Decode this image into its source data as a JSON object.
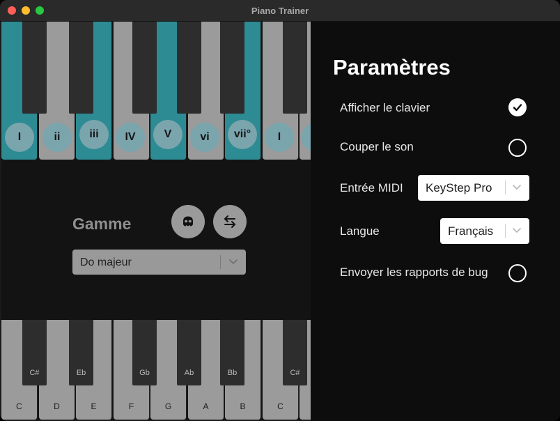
{
  "window": {
    "title": "Piano Trainer"
  },
  "top_keyboard": {
    "degrees": [
      "I",
      "ii",
      "iii",
      "IV",
      "V",
      "vi",
      "vii°",
      "I",
      ""
    ],
    "highlighted_keys": [
      "C",
      "E",
      "G",
      "B"
    ],
    "highlight_color": "#2d8b93"
  },
  "scale_panel": {
    "label": "Gamme",
    "mask_button_icon": "mask-icon",
    "swap_button_icon": "swap-arrows-icon",
    "scale_select": {
      "value": "Do majeur"
    }
  },
  "bottom_keyboard": {
    "white_keys": [
      "C",
      "D",
      "E",
      "F",
      "G",
      "A",
      "B",
      "C",
      ""
    ],
    "black_keys": [
      "C#",
      "Eb",
      "Gb",
      "Ab",
      "Bb",
      "C#"
    ]
  },
  "settings": {
    "title": "Paramètres",
    "show_keyboard": {
      "label": "Afficher le clavier",
      "checked": true
    },
    "mute": {
      "label": "Couper le son",
      "checked": false
    },
    "midi_input": {
      "label": "Entrée MIDI",
      "value": "KeyStep Pro"
    },
    "language": {
      "label": "Langue",
      "value": "Français"
    },
    "bug_reports": {
      "label": "Envoyer les rapports de bug",
      "checked": false
    }
  }
}
